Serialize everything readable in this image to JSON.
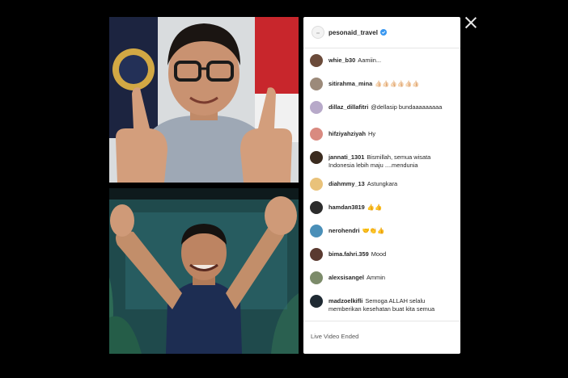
{
  "live": {
    "host": "pesonaid_travel",
    "status": "Live Video Ended"
  },
  "comments": [
    {
      "user": "whie_b30",
      "text": "Aamiin...",
      "avatar_color": "#6b4b3a"
    },
    {
      "user": "sitirahma_mina",
      "text": "👍🏻👍🏻👍🏻👍🏻👍🏻👍🏻",
      "avatar_color": "#9c8a7a"
    },
    {
      "user": "dillaz_dillafitri",
      "text": "@dellasip bundaaaaaaaaa",
      "avatar_color": "#b7a9c9"
    },
    {
      "user": "hifziyahziyah",
      "text": "Hy",
      "avatar_color": "#d98a80"
    },
    {
      "user": "jannati_1301",
      "text": "Bismillah, semua wisata Indonesia lebih maju ....mendunia",
      "avatar_color": "#3b2b1f"
    },
    {
      "user": "diahmmy_13",
      "text": "Astungkara",
      "avatar_color": "#e9c27a"
    },
    {
      "user": "hamdan3819",
      "text": "👍👍",
      "avatar_color": "#2c2c2c"
    },
    {
      "user": "nerohendri",
      "text": "🤝👏👍",
      "avatar_color": "#4a8fb8"
    },
    {
      "user": "bima.fahri.359",
      "text": "Mood",
      "avatar_color": "#5a3a30"
    },
    {
      "user": "alexsisangel",
      "text": "Ammin",
      "avatar_color": "#7c8b6a"
    },
    {
      "user": "madzoelkifli",
      "text": "Semoga ALLAH selalu memberikan kesehatan buat kita semua",
      "avatar_color": "#1f2a33"
    }
  ],
  "colors": {
    "background": "#000000",
    "panel": "#ffffff",
    "verified": "#3897f0"
  },
  "icons": {
    "close": "close-icon",
    "verified": "verified-badge-icon"
  }
}
